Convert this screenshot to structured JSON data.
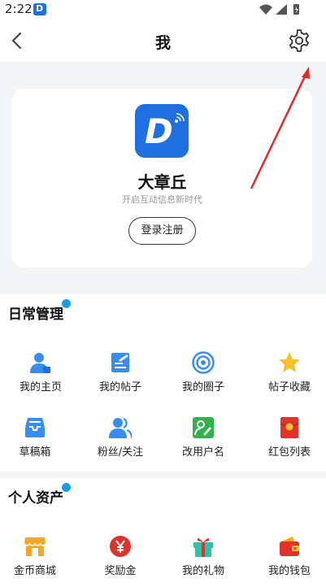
{
  "status_bar": {
    "time": "2:22",
    "app_icon_letter": "D"
  },
  "header": {
    "title": "我"
  },
  "profile": {
    "name": "大章丘",
    "slogan": "开启互动信息新时代",
    "login_label": "登录注册",
    "logo_letter": "D"
  },
  "sections": [
    {
      "title": "日常管理",
      "items": [
        {
          "label": "我的主页",
          "icon": "user-home-icon"
        },
        {
          "label": "我的帖子",
          "icon": "post-edit-icon"
        },
        {
          "label": "我的圈子",
          "icon": "circle-target-icon"
        },
        {
          "label": "帖子收藏",
          "icon": "star-icon"
        },
        {
          "label": "草稿箱",
          "icon": "inbox-tray-icon"
        },
        {
          "label": "粉丝/关注",
          "icon": "followers-icon"
        },
        {
          "label": "改用户名",
          "icon": "rename-icon"
        },
        {
          "label": "红包列表",
          "icon": "red-envelope-icon"
        }
      ]
    },
    {
      "title": "个人资产",
      "items": [
        {
          "label": "金币商城",
          "icon": "store-icon"
        },
        {
          "label": "奖励金",
          "icon": "yuan-coin-icon"
        },
        {
          "label": "我的礼物",
          "icon": "gift-icon"
        },
        {
          "label": "我的钱包",
          "icon": "wallet-icon"
        }
      ]
    }
  ],
  "colors": {
    "brand_blue": "#1f6fe0",
    "icon_blue": "#3a8df0",
    "badge_blue": "#1a9be6",
    "star_yellow": "#f6c22b",
    "green": "#2fb34a",
    "red": "#e0322a",
    "store_orange": "#f5a623",
    "gift_teal": "#2cc3a6",
    "annotation_red": "#e8262a",
    "page_bg": "#f4f5f7"
  }
}
